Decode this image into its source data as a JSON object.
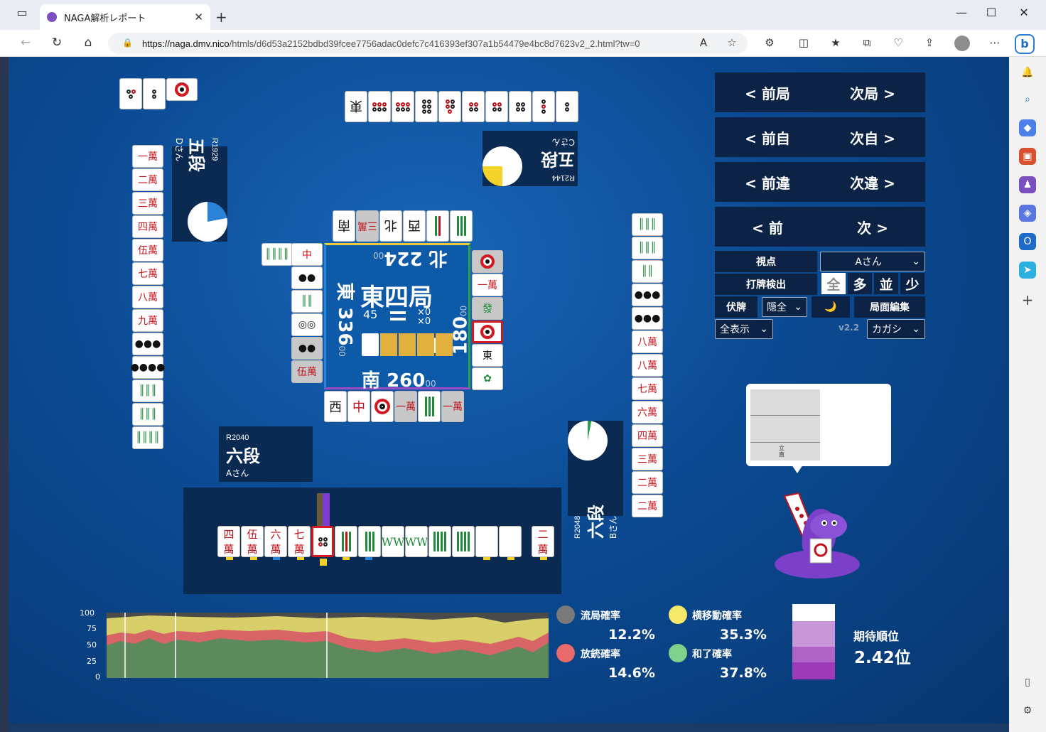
{
  "browser": {
    "tab_title": "NAGA解析レポート",
    "url_host": "https://naga.dmv.nico",
    "url_path": "/htmls/d6d53a2152bdbd39fcee7756adac0defc7c416393ef307a1b54479e4bc8d7623v2_2.html?tw=0"
  },
  "controls": {
    "prev_round": "< 前局",
    "next_round": "次局 >",
    "prev_self": "< 前自",
    "next_self": "次自 >",
    "prev_diff": "< 前違",
    "next_diff": "次違 >",
    "prev": "< 前",
    "next": "次 >",
    "viewpoint_label": "視点",
    "viewpoint_value": "Aさん",
    "detect_label": "打牌検出",
    "detect_options": [
      "全",
      "多",
      "並",
      "少"
    ],
    "hidden_label": "伏牌",
    "hidden_value": "隠全",
    "moon_icon": "🌙",
    "edit_label": "局面編集",
    "display_value": "全表示",
    "version": "v2.2",
    "model_value": "カガシ"
  },
  "board": {
    "round": "東四局",
    "count": "45",
    "honba": "×0",
    "kyotaku": "×0",
    "seats": {
      "east": {
        "label": "東",
        "score": "336",
        "suffix": "00"
      },
      "south": {
        "label": "南",
        "score": "260",
        "suffix": "00"
      },
      "west": {
        "label": "西",
        "score": "180",
        "suffix": "00"
      },
      "north": {
        "label": "北",
        "score": "224",
        "suffix": "00"
      }
    }
  },
  "players": {
    "self": {
      "rate": "R2040",
      "dan": "六段",
      "name": "Aさん",
      "pie_fraction": 0.0
    },
    "right": {
      "rate": "R2048",
      "dan": "六段",
      "name": "Bさん",
      "pie_fraction": 0.03
    },
    "top": {
      "rate": "R2144",
      "dan": "五段",
      "name": "Cさん",
      "pie_fraction": 0.25
    },
    "left": {
      "rate": "R1929",
      "dan": "五段",
      "name": "Dさん",
      "pie_fraction": 0.22
    }
  },
  "hand": [
    "四",
    "伍",
    "六",
    "七"
  ],
  "hand_suffix": "萬",
  "drawn_tile": "二",
  "popup_label": "立直",
  "graph": {
    "y_ticks": [
      "100",
      "75",
      "50",
      "25",
      "0"
    ]
  },
  "stats": {
    "ryukyoku_label": "流局確率",
    "ryukyoku_value": "12.2%",
    "yoko_label": "横移動確率",
    "yoko_value": "35.3%",
    "houju_label": "放銃確率",
    "houju_value": "14.6%",
    "agari_label": "和了確率",
    "agari_value": "37.8%",
    "expected_label": "期待順位",
    "expected_value": "2.42位"
  },
  "colors": {
    "ryukyoku": "#7a7a7a",
    "yoko": "#f6e96a",
    "houju": "#e86a6a",
    "agari": "#7fd08a"
  }
}
